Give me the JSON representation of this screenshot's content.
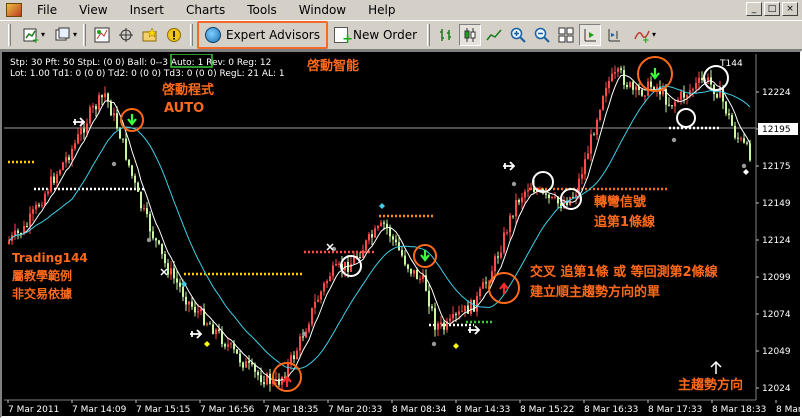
{
  "menu": {
    "items": [
      "File",
      "View",
      "Insert",
      "Charts",
      "Tools",
      "Window",
      "Help"
    ],
    "window_buttons": [
      "_",
      "□",
      "×"
    ]
  },
  "toolbar": {
    "expert_advisors_label": "Expert Advisors",
    "new_order_label": "New Order",
    "highlight_color": "#f26b2a"
  },
  "chart": {
    "symbol_label": "T144",
    "current_price_label": "12195",
    "price_ticks": [
      "12224",
      "12195",
      "12175",
      "12149",
      "12124",
      "12099",
      "12074",
      "12049",
      "12024"
    ],
    "time_ticks": [
      "7 Mar 2011",
      "7 Mar 14:09",
      "7 Mar 15:15",
      "7 Mar 16:56",
      "7 Mar 18:35",
      "7 Mar 20:33",
      "8 Mar 08:34",
      "8 Mar 14:33",
      "8 Mar 15:22",
      "8 Mar 16:33",
      "8 Mar 17:33",
      "8 Mar 18:33",
      "8 Mar 20:53"
    ],
    "params_line1": "Stp: 30  Pft: 50  StpL: (0 0)  Ball: 0--3  Auto: 1  Rev: 0  Reg: 12",
    "params_line2": "Lot: 1.00  Td1: 0 (0 0)  Td2: 0 (0 0)  Td3: 0 (0 0)  RegL: 21  AL: 1",
    "annotations": {
      "smart_start": "啓動智能",
      "start_program": "啓動程式",
      "auto": "AUTO",
      "turn_signal": "轉彎信號",
      "follow_line1": "追第1條線",
      "crossover": "交叉 追第1條 或 等回測第2條線",
      "build_order": "建立順主趨勢方向的單",
      "trading144": "Trading144",
      "teaching_example": "屬教學範例",
      "not_basis": "非交易依據",
      "main_trend": "主趨勢方向"
    },
    "colors": {
      "bull": "#ff4a4a",
      "bear": "#c8f7a0",
      "ma_fast": "#ffffff",
      "ma_slow": "#3fd0e8",
      "annotation": "#ff6a1a",
      "stop_level": "#ffcc00"
    }
  }
}
